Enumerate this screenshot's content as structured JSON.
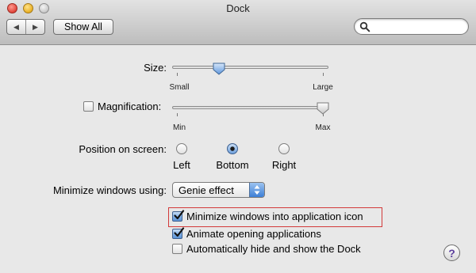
{
  "window": {
    "title": "Dock",
    "traffic_lights": [
      "close",
      "minimize",
      "zoom"
    ]
  },
  "toolbar": {
    "back_icon": "◀",
    "forward_icon": "▶",
    "show_all_label": "Show All",
    "search": {
      "value": "",
      "placeholder": ""
    }
  },
  "size": {
    "label": "Size:",
    "min_label": "Small",
    "max_label": "Large",
    "value_fraction": 0.3
  },
  "magnification": {
    "label": "Magnification:",
    "checked": false,
    "min_label": "Min",
    "max_label": "Max",
    "value_fraction": 0.96,
    "enabled": false
  },
  "position": {
    "label": "Position on screen:",
    "options": [
      "Left",
      "Bottom",
      "Right"
    ],
    "selected": "Bottom"
  },
  "minimize": {
    "label": "Minimize windows using:",
    "selected": "Genie effect"
  },
  "options": [
    {
      "label": "Minimize windows into application icon",
      "checked": true,
      "highlighted": true
    },
    {
      "label": "Animate opening applications",
      "checked": true,
      "highlighted": false
    },
    {
      "label": "Automatically hide and show the Dock",
      "checked": false,
      "highlighted": false
    }
  ],
  "help": {
    "label": "?"
  },
  "colors": {
    "highlight_border": "#d33a3a",
    "accent_blue": "#5f95d6",
    "help_glyph": "#5b3e9c"
  }
}
